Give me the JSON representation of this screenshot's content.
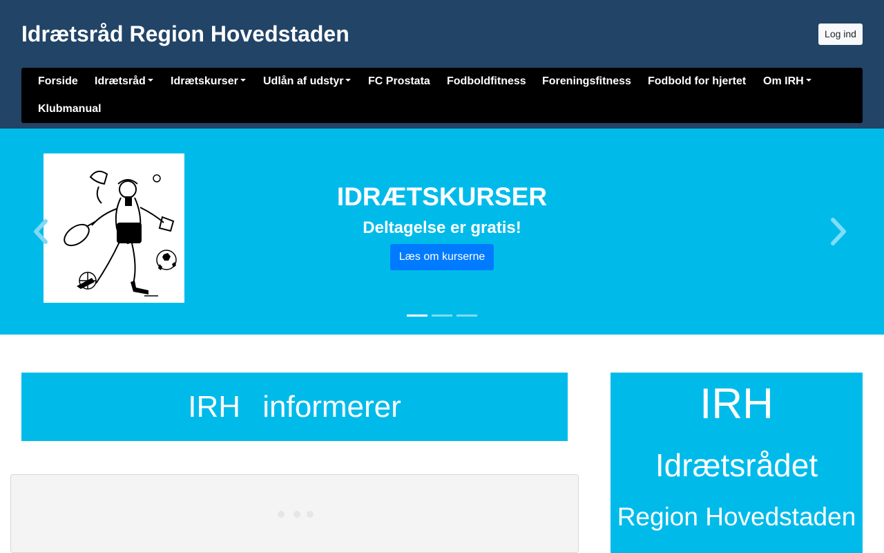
{
  "header": {
    "site_title": "Idrætsråd Region Hovedstaden",
    "login_label": "Log ind"
  },
  "nav": {
    "items": [
      {
        "label": "Forside",
        "dropdown": false
      },
      {
        "label": "Idrætsråd",
        "dropdown": true
      },
      {
        "label": "Idrætskurser",
        "dropdown": true
      },
      {
        "label": "Udlån af udstyr",
        "dropdown": true
      },
      {
        "label": "FC Prostata",
        "dropdown": false
      },
      {
        "label": "Fodboldfitness",
        "dropdown": false
      },
      {
        "label": "Foreningsfitness",
        "dropdown": false
      },
      {
        "label": "Fodbold for hjertet",
        "dropdown": false
      },
      {
        "label": "Om IRH",
        "dropdown": true
      },
      {
        "label": "Klubmanual",
        "dropdown": false
      }
    ]
  },
  "carousel": {
    "title": "IDRÆTSKURSER",
    "subtitle": "Deltagelse er gratis!",
    "button_label": "Læs om kurserne",
    "slide_count": 3,
    "active_slide": 1,
    "prev_icon": "chevron-left-icon",
    "next_icon": "chevron-right-icon"
  },
  "info_banner": {
    "text": "IRH informerer"
  },
  "side_banner": {
    "line1": "IRH",
    "line2": "Idrætsrådet",
    "line3": "Region Hovedstaden"
  },
  "colors": {
    "header_bg": "#214467",
    "nav_bg": "#000000",
    "accent_cyan": "#00bbea",
    "primary_button": "#007bff"
  }
}
